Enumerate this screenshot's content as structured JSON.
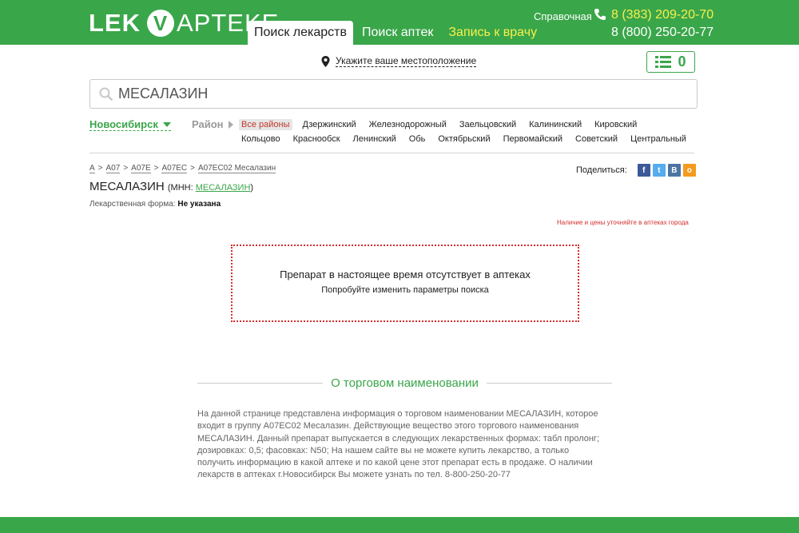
{
  "header": {
    "logo": {
      "part1": "LEK",
      "part2": "V",
      "part3": "APTEKE"
    },
    "nav": [
      {
        "label": "Поиск лекарств",
        "active": true
      },
      {
        "label": "Поиск аптек",
        "active": false
      },
      {
        "label": "Запись к врачу",
        "active": false
      }
    ],
    "help_label": "Справочная",
    "phone1": "8 (383) 209-20-70",
    "phone2": "8 (800) 250-20-77"
  },
  "location": {
    "label": "Укажите ваше местоположение"
  },
  "cart": {
    "count": "0"
  },
  "search": {
    "value": "МЕСАЛАЗИН"
  },
  "filters": {
    "city": "Новосибирск",
    "rayon": "Район",
    "districts_row1": [
      "Все районы",
      "Дзержинский",
      "Железнодорожный",
      "Заельцовский",
      "Калининский",
      "Кировский"
    ],
    "districts_row2": [
      "Кольцово",
      "Краснообск",
      "Ленинский",
      "Обь",
      "Октябрьский",
      "Первомайский",
      "Советский",
      "Центральный"
    ]
  },
  "breadcrumbs": [
    {
      "label": "A",
      "sep": ">"
    },
    {
      "label": "A07",
      "sep": ">"
    },
    {
      "label": "A07E",
      "sep": ">"
    },
    {
      "label": "A07EC",
      "sep": ">"
    },
    {
      "label": "A07EC02 Месалазин",
      "sep": ""
    }
  ],
  "share": {
    "label": "Поделиться:",
    "networks": [
      {
        "name": "facebook-icon",
        "glyph": "f",
        "color": "#3b5998"
      },
      {
        "name": "twitter-icon",
        "glyph": "t",
        "color": "#55acee"
      },
      {
        "name": "vk-icon",
        "glyph": "В",
        "color": "#4c75a3"
      },
      {
        "name": "odnoklassniki-icon",
        "glyph": "о",
        "color": "#f59a1f"
      }
    ]
  },
  "product": {
    "title": "МЕСАЛАЗИН",
    "mnn_prefix": "(МНН: ",
    "mnn": "МЕСАЛАЗИН",
    "mnn_suffix": ")",
    "form_label": "Лекарственная форма:",
    "form_value": "Не указана",
    "notice": "Наличие и цены уточняйте в аптеках города"
  },
  "empty": {
    "heading": "Препарат в настоящее время отсутствует в аптеках",
    "sub": "Попробуйте изменить параметры поиска"
  },
  "about": {
    "title": "О торговом наименовании",
    "text": "На данной странице представлена информация о торговом наименовании МЕСАЛАЗИН, которое входит в группу A07EC02 Месалазин. Действующие вещество этого торгового наименования МЕСАЛАЗИН. Данный препарат выпускается в следующих лекарственных формах: табл пролонг; дозировках: 0,5; фасовках: N50; На нашем сайте вы не можете купить лекарство, а только получить информацию в какой аптеке и по какой цене этот препарат есть в продаже. О наличии лекарств в аптеках г.Новосибирск Вы можете узнать по тел. 8-800-250-20-77"
  },
  "colors": {
    "brand_green": "#3aa64a",
    "accent_yellow": "#f6f04a",
    "alert_red": "#d32f2f"
  }
}
